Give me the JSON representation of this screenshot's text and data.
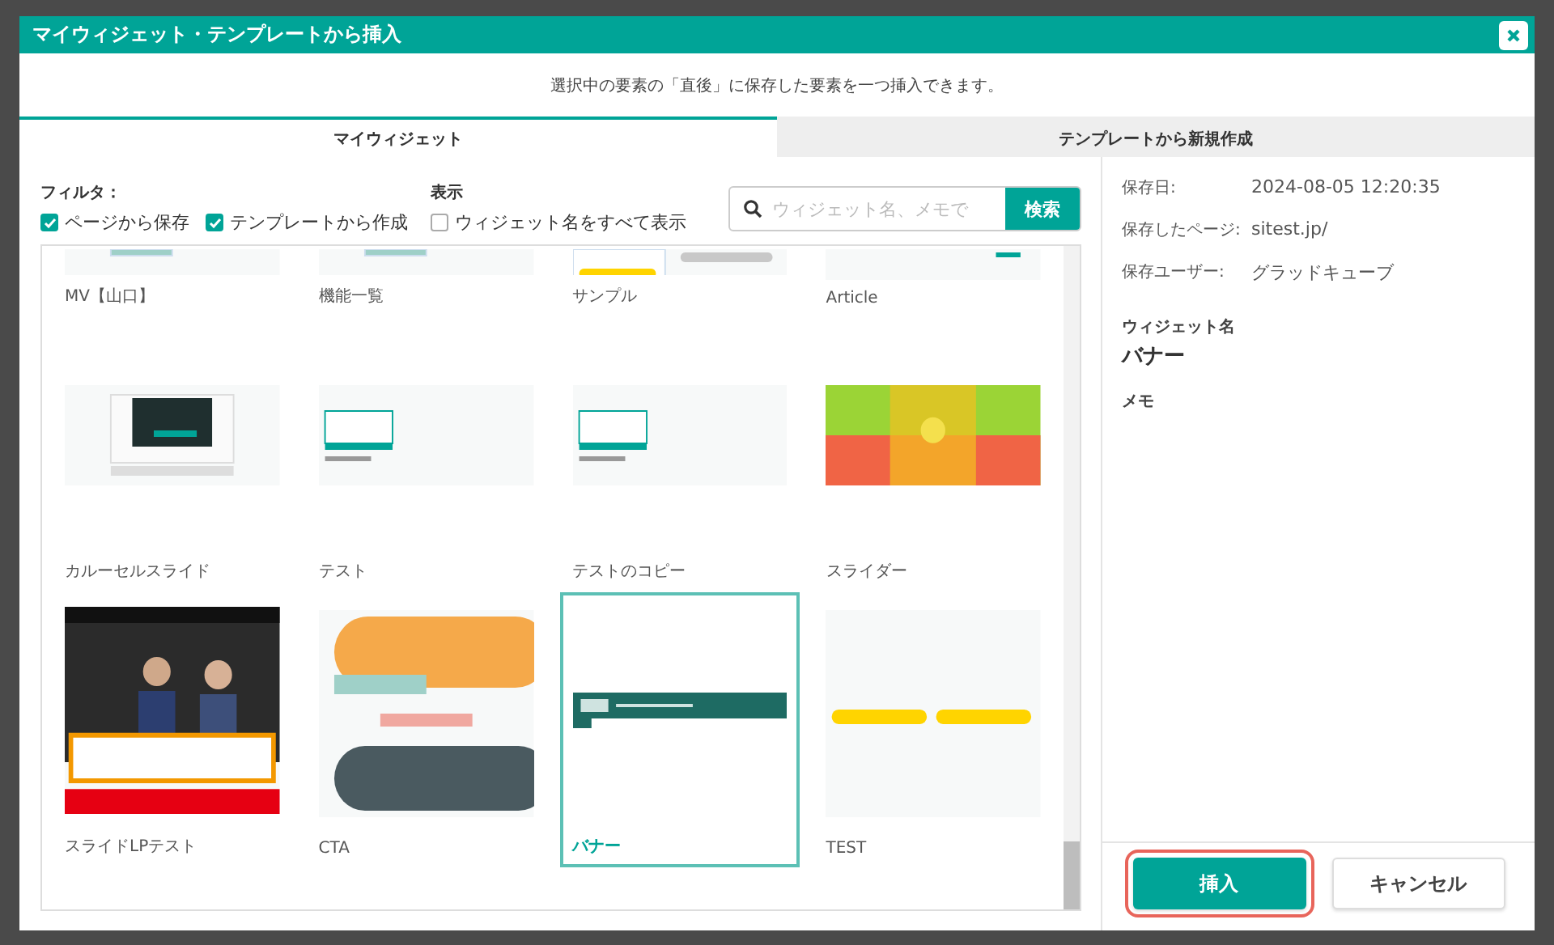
{
  "dialog": {
    "title": "マイウィジェット・テンプレートから挿入",
    "notice": "選択中の要素の「直後」に保存した要素を一つ挿入できます。"
  },
  "tabs": [
    {
      "label": "マイウィジェット",
      "selected": true
    },
    {
      "label": "テンプレートから新規作成",
      "selected": false
    }
  ],
  "filter": {
    "label": "フィルタ：",
    "options": [
      {
        "label": "ページから保存",
        "checked": true
      },
      {
        "label": "テンプレートから作成",
        "checked": true
      }
    ]
  },
  "display": {
    "label": "表示",
    "options": [
      {
        "label": "ウィジェット名をすべて表示",
        "checked": false
      }
    ]
  },
  "search": {
    "placeholder": "ウィジェット名、メモで",
    "button": "検索"
  },
  "widgets": [
    {
      "name": "MV【山口】",
      "selected": false
    },
    {
      "name": "機能一覧",
      "selected": false
    },
    {
      "name": "サンプル",
      "selected": false
    },
    {
      "name": "Article",
      "selected": false
    },
    {
      "name": "カルーセルスライド",
      "selected": false
    },
    {
      "name": "テスト",
      "selected": false
    },
    {
      "name": "テストのコピー",
      "selected": false
    },
    {
      "name": "スライダー",
      "selected": false
    },
    {
      "name": "スライドLPテスト",
      "selected": false
    },
    {
      "name": "CTA",
      "selected": false
    },
    {
      "name": "バナー",
      "selected": true
    },
    {
      "name": "TEST",
      "selected": false
    }
  ],
  "details": {
    "fields": [
      {
        "label": "保存日:",
        "value": "2024-08-05 12:20:35"
      },
      {
        "label": "保存したページ:",
        "value": "sitest.jp/"
      },
      {
        "label": "保存ユーザー:",
        "value": "グラッドキューブ"
      }
    ],
    "widget_name_label": "ウィジェット名",
    "widget_name": "バナー",
    "memo_label": "メモ"
  },
  "buttons": [
    {
      "label": "挿入",
      "kind": "primary",
      "focused": true
    },
    {
      "label": "キャンセル",
      "kind": "secondary",
      "focused": false
    }
  ]
}
